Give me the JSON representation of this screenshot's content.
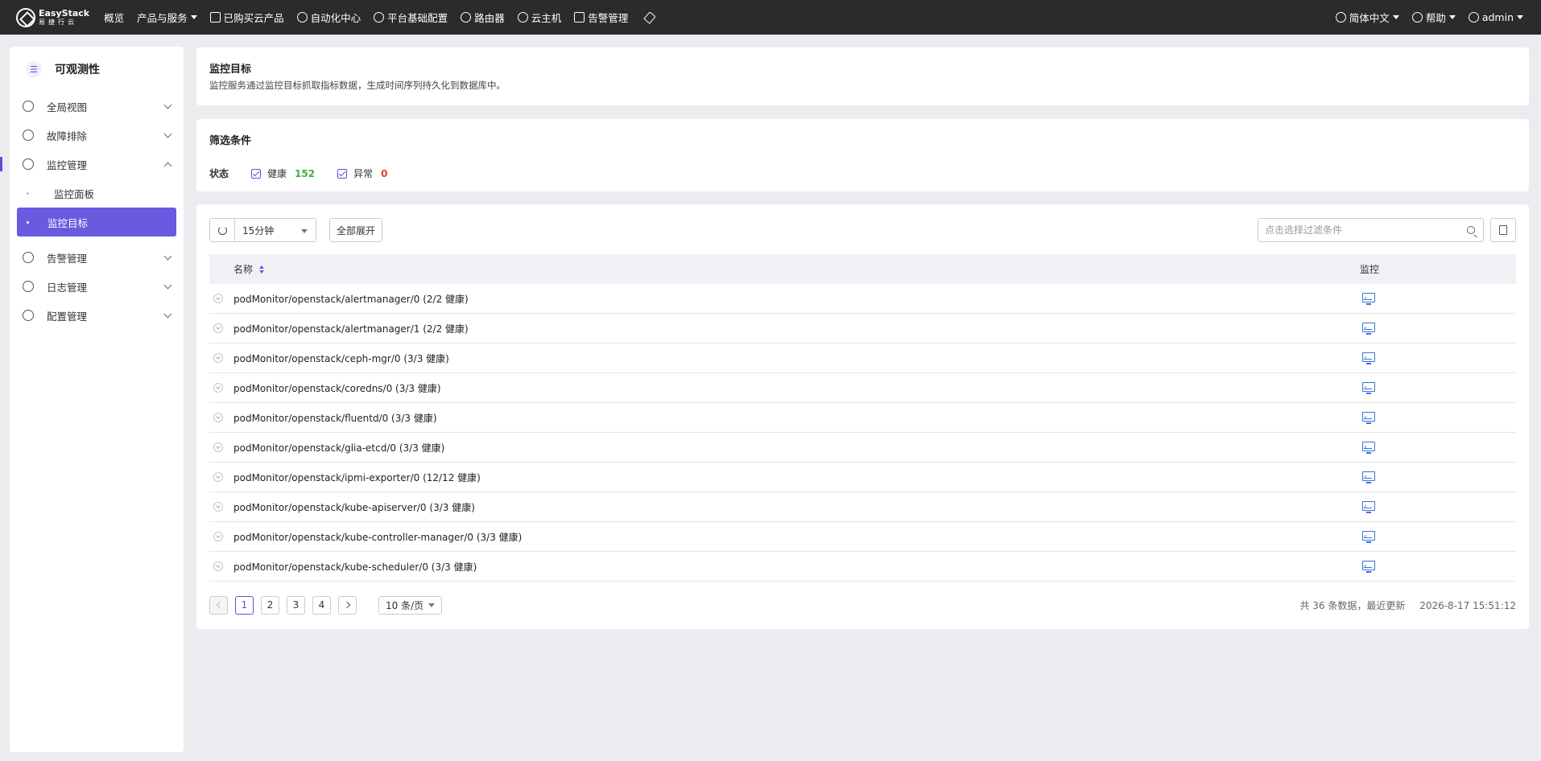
{
  "topbar": {
    "brand_line1": "EasyStack",
    "brand_line2": "易捷行云",
    "nav": [
      {
        "label": "概览"
      },
      {
        "label": "产品与服务"
      },
      {
        "label": "已购买云产品"
      },
      {
        "label": "自动化中心"
      },
      {
        "label": "平台基础配置"
      },
      {
        "label": "路由器"
      },
      {
        "label": "云主机"
      },
      {
        "label": "告警管理"
      }
    ],
    "language": "简体中文",
    "help": "帮助",
    "user": "admin"
  },
  "sidebar": {
    "title": "可观测性",
    "items": [
      {
        "label": "全局视图"
      },
      {
        "label": "故障排除"
      },
      {
        "label": "监控管理"
      },
      {
        "label": "告警管理"
      },
      {
        "label": "日志管理"
      },
      {
        "label": "配置管理"
      }
    ],
    "subitems": [
      {
        "label": "监控面板"
      },
      {
        "label": "监控目标"
      }
    ]
  },
  "header": {
    "title": "监控目标",
    "desc": "监控服务通过监控目标抓取指标数据，生成时间序列持久化到数据库中。"
  },
  "filter": {
    "title": "筛选条件",
    "status_label": "状态",
    "healthy_label": "健康",
    "healthy_count": "152",
    "abnormal_label": "异常",
    "abnormal_count": "0"
  },
  "toolbar": {
    "interval": "15分钟",
    "expand_all": "全部展开",
    "search_placeholder": "点击选择过滤条件"
  },
  "table": {
    "col_name": "名称",
    "col_monitor": "监控",
    "rows": [
      "podMonitor/openstack/alertmanager/0 (2/2 健康)",
      "podMonitor/openstack/alertmanager/1 (2/2 健康)",
      "podMonitor/openstack/ceph-mgr/0 (3/3 健康)",
      "podMonitor/openstack/coredns/0 (3/3 健康)",
      "podMonitor/openstack/fluentd/0 (3/3 健康)",
      "podMonitor/openstack/glia-etcd/0 (3/3 健康)",
      "podMonitor/openstack/ipmi-exporter/0 (12/12 健康)",
      "podMonitor/openstack/kube-apiserver/0 (3/3 健康)",
      "podMonitor/openstack/kube-controller-manager/0 (3/3 健康)",
      "podMonitor/openstack/kube-scheduler/0 (3/3 健康)"
    ]
  },
  "pagination": {
    "pages": [
      "1",
      "2",
      "3",
      "4"
    ],
    "current": "1",
    "page_size": "10 条/页",
    "total_text": "共 36 条数据，最近更新",
    "updated_at": "2026-8-17 15:51:12"
  },
  "colors": {
    "accent": "#6a5ae0",
    "healthy": "#3db33d",
    "abnormal": "#e23b2e",
    "topbar": "#2b2b2b"
  }
}
